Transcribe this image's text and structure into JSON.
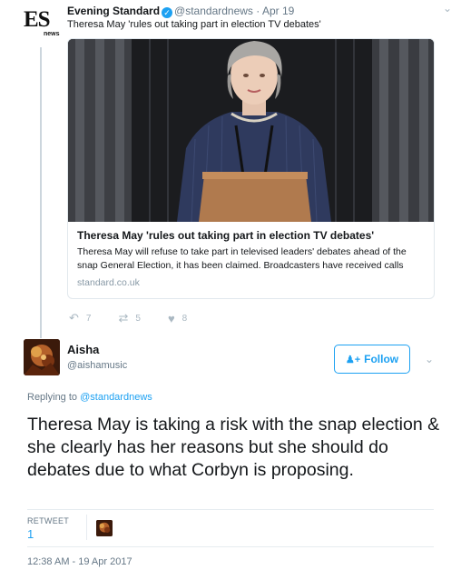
{
  "parent_tweet": {
    "logo_text": "ES",
    "logo_sub": "news",
    "display_name": "Evening Standard",
    "handle": "@standardnews",
    "date": "Apr 19",
    "separator": "·",
    "text": "Theresa May 'rules out taking part in election TV debates'",
    "card": {
      "title": "Theresa May 'rules out taking part in election TV debates'",
      "description": "Theresa May will refuse to take part in televised leaders' debates ahead of the snap General Election, it has been claimed. Broadcasters have received calls",
      "domain": "standard.co.uk"
    },
    "actions": {
      "replies": "7",
      "retweets": "5",
      "likes": "8"
    }
  },
  "main_tweet": {
    "display_name": "Aisha",
    "handle": "@aishamusic",
    "follow_label": "Follow",
    "replying_to_prefix": "Replying to",
    "replying_to_handle": "@standardnews",
    "text": "Theresa May is taking a risk with the snap election & she clearly has her reasons but she should do debates due to what Corbyn is proposing.",
    "retweet_label": "RETWEET",
    "retweet_count": "1",
    "timestamp": "12:38 AM - 19 Apr 2017"
  },
  "icons": {
    "verified": "verified-badge-icon",
    "reply": "reply-icon",
    "retweet": "retweet-icon",
    "like": "heart-icon",
    "caret": "chevron-down-icon",
    "follow": "add-person-icon"
  },
  "colors": {
    "accent": "#1da1f2",
    "muted": "#657786",
    "border": "#e1e8ed"
  }
}
